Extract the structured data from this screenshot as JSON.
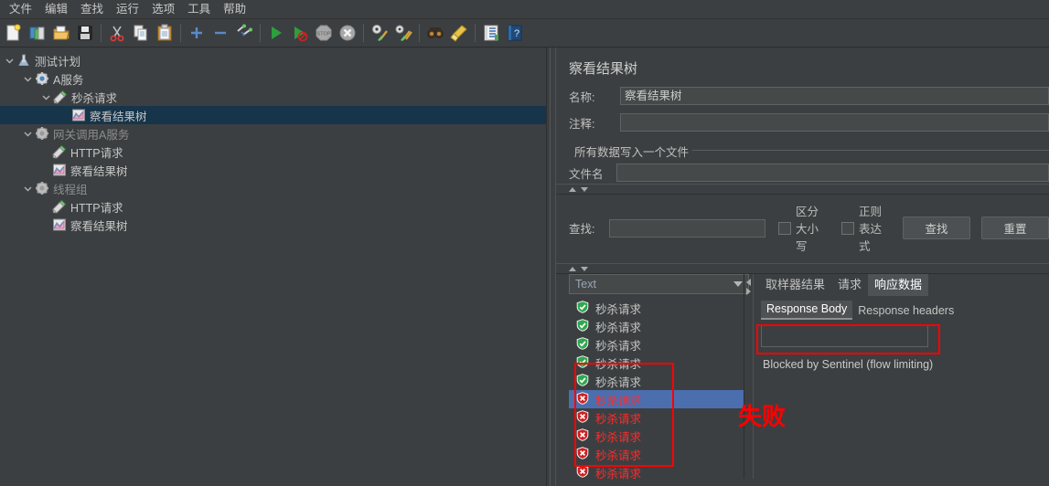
{
  "menu": {
    "items": [
      {
        "label": "文件",
        "name": "menu-file"
      },
      {
        "label": "编辑",
        "name": "menu-edit"
      },
      {
        "label": "查找",
        "name": "menu-search"
      },
      {
        "label": "运行",
        "name": "menu-run"
      },
      {
        "label": "选项",
        "name": "menu-options"
      },
      {
        "label": "工具",
        "name": "menu-tools"
      },
      {
        "label": "帮助",
        "name": "menu-help"
      }
    ]
  },
  "toolbar": {
    "buttons": [
      {
        "icon": "new-file-icon",
        "name": "new-button"
      },
      {
        "icon": "templates-icon",
        "name": "templates-button"
      },
      {
        "icon": "open-folder-icon",
        "name": "open-button"
      },
      {
        "icon": "save-floppy-icon",
        "name": "save-button"
      },
      {
        "icon": "separator",
        "name": "toolbar-separator-1"
      },
      {
        "icon": "scissors-icon",
        "name": "cut-button"
      },
      {
        "icon": "copy-icon",
        "name": "copy-button"
      },
      {
        "icon": "clipboard-icon",
        "name": "paste-button"
      },
      {
        "icon": "separator",
        "name": "toolbar-separator-2"
      },
      {
        "icon": "plus-icon",
        "name": "expand-all-button"
      },
      {
        "icon": "minus-icon",
        "name": "collapse-all-button"
      },
      {
        "icon": "toggle-icon",
        "name": "toggle-button"
      },
      {
        "icon": "separator",
        "name": "toolbar-separator-3"
      },
      {
        "icon": "play-icon",
        "name": "start-button"
      },
      {
        "icon": "play-no-timer-icon",
        "name": "start-no-pauses-button"
      },
      {
        "icon": "stop-icon",
        "name": "stop-button"
      },
      {
        "icon": "shutdown-icon",
        "name": "shutdown-button"
      },
      {
        "icon": "separator",
        "name": "toolbar-separator-4"
      },
      {
        "icon": "clear-icon",
        "name": "clear-button"
      },
      {
        "icon": "clear-all-icon",
        "name": "clear-all-button"
      },
      {
        "icon": "separator",
        "name": "toolbar-separator-5"
      },
      {
        "icon": "binoculars-icon",
        "name": "search-button"
      },
      {
        "icon": "broom-icon",
        "name": "search-reset-button"
      },
      {
        "icon": "separator",
        "name": "toolbar-separator-6"
      },
      {
        "icon": "function-helper-icon",
        "name": "function-helper-button"
      },
      {
        "icon": "help-icon",
        "name": "help-button"
      }
    ]
  },
  "tree": {
    "nodes": [
      {
        "label": "测试计划",
        "icon": "test-plan-icon",
        "depth": 0,
        "twist": "down",
        "selected": false,
        "dim": false
      },
      {
        "label": "A服务",
        "icon": "thread-group-icon",
        "depth": 1,
        "twist": "down",
        "selected": false,
        "dim": false
      },
      {
        "label": "秒杀请求",
        "icon": "http-sampler-icon",
        "depth": 2,
        "twist": "down",
        "selected": false,
        "dim": false
      },
      {
        "label": "察看结果树",
        "icon": "view-results-tree-icon",
        "depth": 3,
        "twist": "none",
        "selected": true,
        "dim": false
      },
      {
        "label": "网关调用A服务",
        "icon": "thread-group-icon",
        "depth": 1,
        "twist": "down",
        "selected": false,
        "dim": true
      },
      {
        "label": "HTTP请求",
        "icon": "http-sampler-icon",
        "depth": 2,
        "twist": "none",
        "selected": false,
        "dim": false
      },
      {
        "label": "察看结果树",
        "icon": "view-results-tree-icon",
        "depth": 2,
        "twist": "none",
        "selected": false,
        "dim": false
      },
      {
        "label": "线程组",
        "icon": "thread-group-icon",
        "depth": 1,
        "twist": "down",
        "selected": false,
        "dim": true
      },
      {
        "label": "HTTP请求",
        "icon": "http-sampler-icon",
        "depth": 2,
        "twist": "none",
        "selected": false,
        "dim": false
      },
      {
        "label": "察看结果树",
        "icon": "view-results-tree-icon",
        "depth": 2,
        "twist": "none",
        "selected": false,
        "dim": false
      }
    ]
  },
  "panel": {
    "title": "察看结果树",
    "name_label": "名称:",
    "name_value": "察看结果树",
    "comment_label": "注释:",
    "comment_value": "",
    "group_legend": "所有数据写入一个文件",
    "filename_label": "文件名",
    "filename_value": ""
  },
  "search": {
    "label": "查找:",
    "value": "",
    "case_sensitive_label": "区分大小写",
    "case_sensitive_checked": false,
    "regex_label": "正则表达式",
    "regex_checked": false,
    "find_button": "查找",
    "reset_button": "重置"
  },
  "results": {
    "render_selector_value": "Text",
    "items": [
      {
        "label": "秒杀请求",
        "status": "success",
        "selected": false
      },
      {
        "label": "秒杀请求",
        "status": "success",
        "selected": false
      },
      {
        "label": "秒杀请求",
        "status": "success",
        "selected": false
      },
      {
        "label": "秒杀请求",
        "status": "success",
        "selected": false
      },
      {
        "label": "秒杀请求",
        "status": "success",
        "selected": false
      },
      {
        "label": "秒杀请求",
        "status": "failure",
        "selected": true
      },
      {
        "label": "秒杀请求",
        "status": "failure",
        "selected": false
      },
      {
        "label": "秒杀请求",
        "status": "failure",
        "selected": false
      },
      {
        "label": "秒杀请求",
        "status": "failure",
        "selected": false
      },
      {
        "label": "秒杀请求",
        "status": "failure",
        "selected": false
      }
    ],
    "tabs": [
      {
        "label": "取样器结果",
        "active": false
      },
      {
        "label": "请求",
        "active": false
      },
      {
        "label": "响应数据",
        "active": true
      }
    ],
    "subtabs": [
      {
        "label": "Response Body",
        "active": true
      },
      {
        "label": "Response headers",
        "active": false
      }
    ],
    "response_search_value": "",
    "response_body": "Blocked by Sentinel (flow limiting)"
  },
  "annotations": {
    "failure_label": "失败",
    "color": "#ff0000"
  }
}
